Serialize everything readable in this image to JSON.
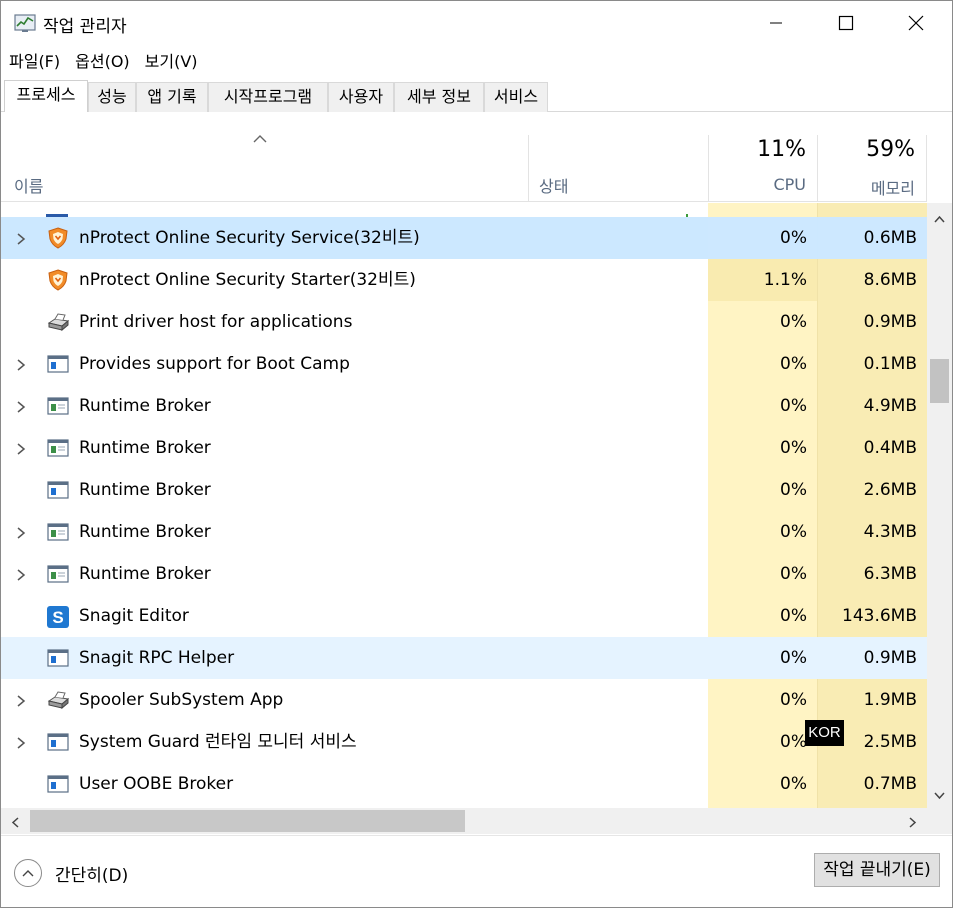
{
  "window": {
    "title": "작업 관리자"
  },
  "menu": [
    "파일(F)",
    "옵션(O)",
    "보기(V)"
  ],
  "tabs": [
    {
      "label": "프로세스",
      "active": true
    },
    {
      "label": "성능",
      "active": false
    },
    {
      "label": "앱 기록",
      "active": false
    },
    {
      "label": "시작프로그램",
      "active": false
    },
    {
      "label": "사용자",
      "active": false
    },
    {
      "label": "세부 정보",
      "active": false
    },
    {
      "label": "서비스",
      "active": false
    }
  ],
  "header": {
    "name": "이름",
    "status": "상태",
    "cpu_pct": "11%",
    "cpu_label": "CPU",
    "mem_pct": "59%",
    "mem_label": "메모리"
  },
  "rows": [
    {
      "name": "nProtect Online Security Service(32비트)",
      "cpu": "0%",
      "mem": "0.6MB",
      "icon": "nprotect-shield-icon",
      "expandable": true,
      "state": "selected"
    },
    {
      "name": "nProtect Online Security Starter(32비트)",
      "cpu": "1.1%",
      "mem": "8.6MB",
      "icon": "nprotect-shield-icon",
      "expandable": false,
      "state": "hot"
    },
    {
      "name": "Print driver host for applications",
      "cpu": "0%",
      "mem": "0.9MB",
      "icon": "printer-icon",
      "expandable": false,
      "state": ""
    },
    {
      "name": "Provides support for Boot Camp",
      "cpu": "0%",
      "mem": "0.1MB",
      "icon": "app-window-icon",
      "expandable": true,
      "state": ""
    },
    {
      "name": "Runtime Broker",
      "cpu": "0%",
      "mem": "4.9MB",
      "icon": "runtime-broker-icon",
      "expandable": true,
      "state": ""
    },
    {
      "name": "Runtime Broker",
      "cpu": "0%",
      "mem": "0.4MB",
      "icon": "runtime-broker-icon",
      "expandable": true,
      "state": ""
    },
    {
      "name": "Runtime Broker",
      "cpu": "0%",
      "mem": "2.6MB",
      "icon": "app-window-icon",
      "expandable": false,
      "state": ""
    },
    {
      "name": "Runtime Broker",
      "cpu": "0%",
      "mem": "4.3MB",
      "icon": "runtime-broker-icon",
      "expandable": true,
      "state": ""
    },
    {
      "name": "Runtime Broker",
      "cpu": "0%",
      "mem": "6.3MB",
      "icon": "runtime-broker-icon",
      "expandable": true,
      "state": ""
    },
    {
      "name": "Snagit Editor",
      "cpu": "0%",
      "mem": "143.6MB",
      "icon": "snagit-icon",
      "expandable": false,
      "state": ""
    },
    {
      "name": "Snagit RPC Helper",
      "cpu": "0%",
      "mem": "0.9MB",
      "icon": "app-window-icon",
      "expandable": false,
      "state": "hover"
    },
    {
      "name": "Spooler SubSystem App",
      "cpu": "0%",
      "mem": "1.9MB",
      "icon": "printer-icon",
      "expandable": true,
      "state": ""
    },
    {
      "name": "System Guard 런타임 모니터 서비스",
      "cpu": "0%",
      "mem": "2.5MB",
      "icon": "app-window-icon",
      "expandable": true,
      "state": ""
    },
    {
      "name": "User OOBE Broker",
      "cpu": "0%",
      "mem": "0.7MB",
      "icon": "app-window-icon",
      "expandable": false,
      "state": ""
    }
  ],
  "footer": {
    "collapse_label": "간단히(D)",
    "end_task_label": "작업 끝내기(E)"
  },
  "ime_indicator": "KOR"
}
